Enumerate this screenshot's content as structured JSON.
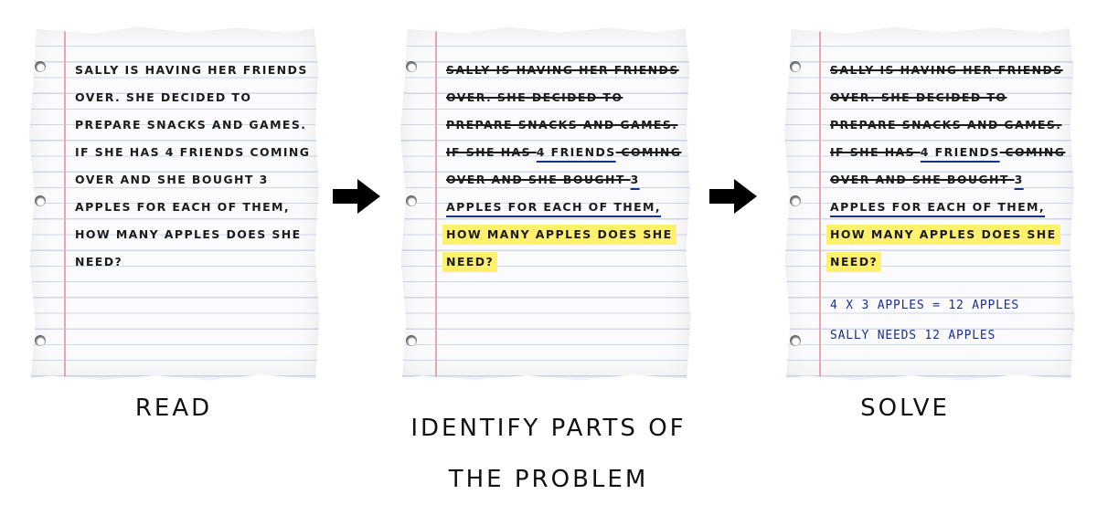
{
  "panels": [
    {
      "lines": [
        "SALLY IS HAVING HER FRIENDS",
        "OVER. SHE DECIDED TO",
        "PREPARE SNACKS AND GAMES.",
        "IF SHE HAS 4 FRIENDS COMING",
        "OVER AND SHE BOUGHT 3",
        "APPLES FOR EACH OF THEM,",
        "HOW MANY APPLES DOES SHE",
        "NEED?"
      ],
      "caption": "READ"
    },
    {
      "lines": [
        "SALLY IS HAVING HER FRIENDS",
        "OVER. SHE DECIDED TO",
        "PREPARE SNACKS AND GAMES.",
        "IF SHE HAS ",
        "4 FRIENDS",
        " COMING",
        "OVER AND SHE BOUGHT ",
        "3",
        "APPLES FOR EACH OF THEM,",
        "HOW MANY APPLES DOES SHE",
        "NEED?"
      ],
      "caption_lines": [
        "IDENTIFY PARTS OF",
        "THE PROBLEM"
      ]
    },
    {
      "lines": [
        "SALLY IS HAVING HER FRIENDS",
        "OVER. SHE DECIDED TO",
        "PREPARE SNACKS AND GAMES.",
        "IF SHE HAS ",
        "4 FRIENDS",
        " COMING",
        "OVER AND SHE BOUGHT ",
        "3",
        "APPLES FOR EACH OF THEM,",
        "HOW MANY APPLES DOES SHE",
        "NEED?"
      ],
      "answer_lines": [
        "4 X 3 APPLES = 12 APPLES",
        "SALLY NEEDS 12 APPLES"
      ],
      "caption": "SOLVE"
    }
  ],
  "colors": {
    "highlight": "#fff06e",
    "underline": "#1c2e8c",
    "handwriting": "#1c2e8c",
    "margin_line": "#e9a7ad",
    "rule_line": "#cfd7ea"
  },
  "icons": [
    "right-arrow-icon",
    "right-arrow-icon"
  ]
}
